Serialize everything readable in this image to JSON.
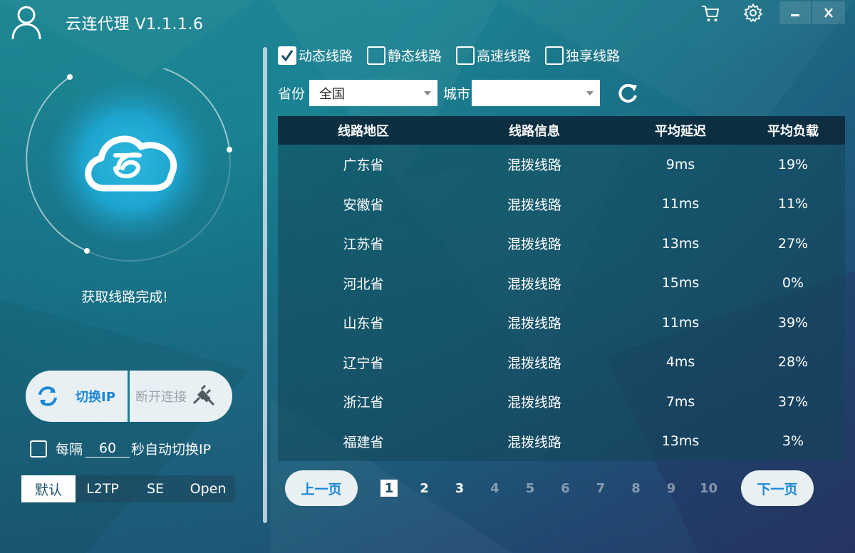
{
  "titlebar": {
    "title": "云连代理 V1.1.1.6",
    "icons": [
      "user-icon",
      "cart-icon",
      "gear-icon",
      "minimize-icon",
      "close-icon"
    ]
  },
  "left_panel": {
    "status": "获取线路完成!",
    "switch_ip_label": "切换IP",
    "disconnect_label": "断开连接",
    "auto_switch": {
      "checked": false,
      "prefix": "每隔",
      "interval": "60",
      "suffix": "秒自动切换IP"
    },
    "mode_tabs": [
      {
        "label": "默认",
        "active": true
      },
      {
        "label": "L2TP",
        "active": false
      },
      {
        "label": "SE",
        "active": false
      },
      {
        "label": "Open",
        "active": false
      }
    ]
  },
  "line_types": [
    {
      "label": "动态线路",
      "checked": true
    },
    {
      "label": "静态线路",
      "checked": false
    },
    {
      "label": "高速线路",
      "checked": false
    },
    {
      "label": "独享线路",
      "checked": false
    }
  ],
  "filters": {
    "province_label": "省份",
    "province_value": "全国",
    "city_label": "城市",
    "city_value": ""
  },
  "table": {
    "headers": [
      "线路地区",
      "线路信息",
      "平均延迟",
      "平均负载"
    ],
    "rows": [
      [
        "广东省",
        "混拨线路",
        "9ms",
        "19%"
      ],
      [
        "安徽省",
        "混拨线路",
        "11ms",
        "11%"
      ],
      [
        "江苏省",
        "混拨线路",
        "13ms",
        "27%"
      ],
      [
        "河北省",
        "混拨线路",
        "15ms",
        "0%"
      ],
      [
        "山东省",
        "混拨线路",
        "11ms",
        "39%"
      ],
      [
        "辽宁省",
        "混拨线路",
        "4ms",
        "28%"
      ],
      [
        "浙江省",
        "混拨线路",
        "7ms",
        "37%"
      ],
      [
        "福建省",
        "混拨线路",
        "13ms",
        "3%"
      ]
    ]
  },
  "pager": {
    "prev_label": "上一页",
    "next_label": "下一页",
    "pages": [
      "1",
      "2",
      "3",
      "4",
      "5",
      "6",
      "7",
      "8",
      "9",
      "10"
    ],
    "current": "1"
  },
  "colors": {
    "accent_blue": "#1b87d6",
    "pill_bg": "#e9f0f4"
  }
}
